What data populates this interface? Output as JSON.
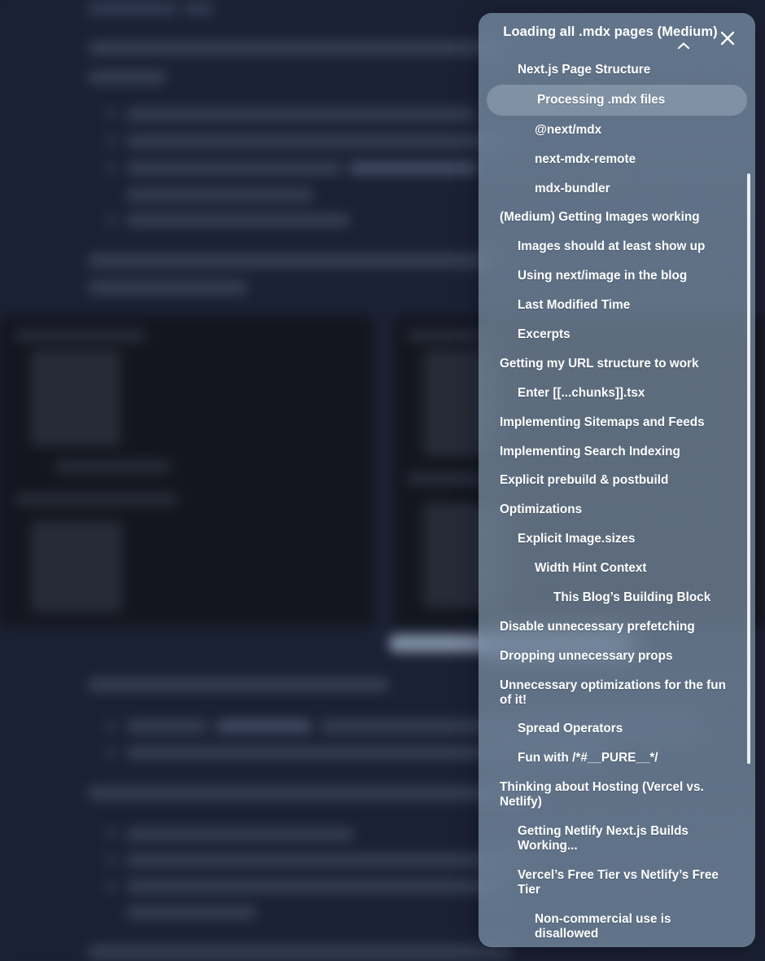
{
  "panel": {
    "title": "Loading all .mdx pages (Medium)",
    "collapse_icon": "chevron-up-icon",
    "close_icon": "close-icon",
    "items": [
      {
        "label": "Next.js Page Structure",
        "level": 1,
        "active": false
      },
      {
        "label": "Processing .mdx files",
        "level": 1,
        "active": true
      },
      {
        "label": "@next/mdx",
        "level": 2,
        "active": false
      },
      {
        "label": "next-mdx-remote",
        "level": 2,
        "active": false
      },
      {
        "label": "mdx-bundler",
        "level": 2,
        "active": false
      },
      {
        "label": "(Medium) Getting Images working",
        "level": 0,
        "active": false
      },
      {
        "label": "Images should at least show up",
        "level": 1,
        "active": false
      },
      {
        "label": "Using next/image in the blog",
        "level": 1,
        "active": false
      },
      {
        "label": "Last Modified Time",
        "level": 1,
        "active": false
      },
      {
        "label": "Excerpts",
        "level": 1,
        "active": false
      },
      {
        "label": "Getting my URL structure to work",
        "level": 0,
        "active": false
      },
      {
        "label": "Enter [[...chunks]].tsx",
        "level": 1,
        "active": false
      },
      {
        "label": "Implementing Sitemaps and Feeds",
        "level": 0,
        "active": false
      },
      {
        "label": "Implementing Search Indexing",
        "level": 0,
        "active": false
      },
      {
        "label": "Explicit prebuild & postbuild",
        "level": 0,
        "active": false
      },
      {
        "label": "Optimizations",
        "level": 0,
        "active": false
      },
      {
        "label": "Explicit Image.sizes",
        "level": 1,
        "active": false
      },
      {
        "label": "Width Hint Context",
        "level": 2,
        "active": false
      },
      {
        "label": "This Blog’s Building Block",
        "level": 3,
        "active": false
      },
      {
        "label": "Disable unnecessary prefetching",
        "level": 0,
        "active": false
      },
      {
        "label": "Dropping unnecessary props",
        "level": 0,
        "active": false
      },
      {
        "label": "Unnecessary optimizations for the fun of it!",
        "level": 0,
        "active": false
      },
      {
        "label": "Spread Operators",
        "level": 1,
        "active": false
      },
      {
        "label": "Fun with /*#__PURE__*/",
        "level": 1,
        "active": false
      },
      {
        "label": "Thinking about Hosting (Vercel vs. Netlify)",
        "level": 0,
        "active": false
      },
      {
        "label": "Getting Netlify Next.js Builds Working...",
        "level": 1,
        "active": false
      },
      {
        "label": "Vercel’s Free Tier vs Netlify’s Free Tier",
        "level": 1,
        "active": false
      },
      {
        "label": "Non-commercial use is disallowed",
        "level": 2,
        "active": false
      }
    ]
  },
  "colors": {
    "page_background": "#1b2134",
    "panel_glass": "#8ba3ba",
    "panel_text": "#ffffff",
    "active_item_background": "#cbd8e4",
    "scrollbar": "#ffffff",
    "code_block": "#14161f"
  },
  "background": {
    "description": "Blurred dark blog article page behind the glass panel"
  }
}
